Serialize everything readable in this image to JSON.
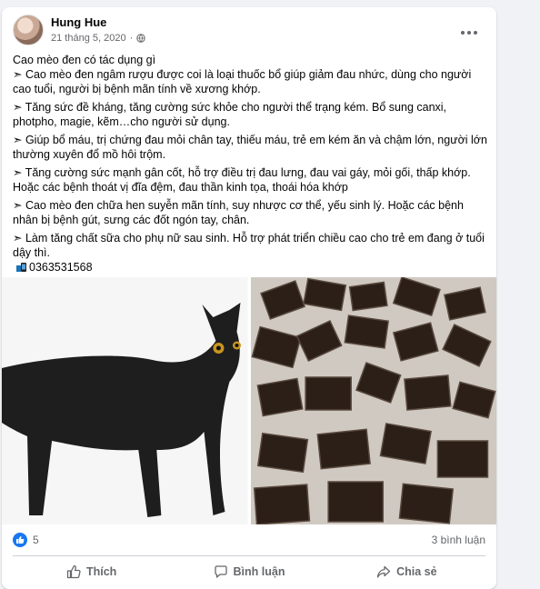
{
  "post": {
    "author": "Hung Hue",
    "date": "21 tháng 5, 2020",
    "privacy_icon": "globe-icon",
    "more_icon": "more-options-icon",
    "paragraphs": [
      "Cao mèo đen có tác dụng gì",
      "➣ Cao mèo đen ngâm rượu được coi là loại thuốc bổ giúp giảm đau nhức, dùng cho người cao tuổi, người bị bệnh mãn tính về xương khớp.",
      "➣ Tăng sức đề kháng, tăng cường sức khỏe cho người thể trạng kém. Bổ sung canxi, photpho, magie, kẽm…cho người sử dụng.",
      "➣ Giúp bổ máu, trị chứng đau mỏi chân tay, thiếu máu, trẻ em kém ăn và chậm lớn, người lớn thường xuyên đổ mồ hôi trộm.",
      "➣ Tăng cường sức mạnh gân cốt, hỗ trợ điều trị đau lưng, đau vai gáy, mỏi gối, thấp khớp. Hoặc các bệnh thoát vị đĩa đệm, đau thần kinh tọa, thoái hóa khớp",
      "➣ Cao mèo đen chữa hen suyễn mãn tính, suy nhược cơ thể, yếu sinh lý. Hoặc các bệnh nhân bị bệnh gút, sưng các đốt ngón tay, chân.",
      "➣ Làm tăng chất sữa cho phụ nữ sau sinh. Hỗ trợ phát triển chiều cao cho trẻ em đang ở tuổi dậy thì."
    ],
    "phone": "0363531568",
    "images": [
      "black cat photo",
      "black cat paste cubes photo"
    ]
  },
  "stats": {
    "reaction_count": "5",
    "comments": "3 bình luận"
  },
  "actions": {
    "like": "Thích",
    "comment": "Bình luận",
    "share": "Chia sẻ"
  },
  "colors": {
    "accent": "#1877f2",
    "secondary_text": "#65676b"
  }
}
